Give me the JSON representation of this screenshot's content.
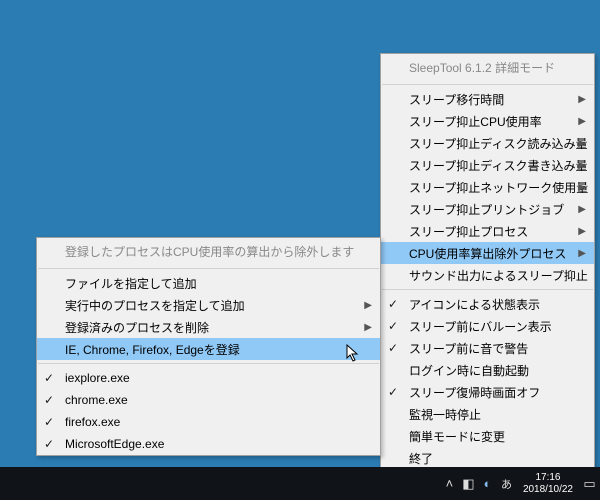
{
  "mainMenu": {
    "title": "SleepTool 6.1.2 詳細モード",
    "items": [
      {
        "label": "スリープ移行時間",
        "submenu": true
      },
      {
        "label": "スリープ抑止CPU使用率",
        "submenu": true
      },
      {
        "label": "スリープ抑止ディスク読み込み量",
        "submenu": true
      },
      {
        "label": "スリープ抑止ディスク書き込み量",
        "submenu": true
      },
      {
        "label": "スリープ抑止ネットワーク使用量",
        "submenu": true
      },
      {
        "label": "スリープ抑止プリントジョブ",
        "submenu": true
      },
      {
        "label": "スリープ抑止プロセス",
        "submenu": true
      },
      {
        "label": "CPU使用率算出除外プロセス",
        "submenu": true,
        "highlighted": true
      },
      {
        "label": "サウンド出力によるスリープ抑止"
      },
      {
        "sep": true
      },
      {
        "label": "アイコンによる状態表示",
        "checked": true
      },
      {
        "label": "スリープ前にバルーン表示",
        "checked": true
      },
      {
        "label": "スリープ前に音で警告",
        "checked": true
      },
      {
        "label": "ログイン時に自動起動"
      },
      {
        "label": "スリープ復帰時画面オフ",
        "checked": true
      },
      {
        "label": "監視一時停止"
      },
      {
        "label": "簡単モードに変更"
      },
      {
        "label": "終了"
      }
    ]
  },
  "subMenu": {
    "title": "登録したプロセスはCPU使用率の算出から除外します",
    "items": [
      {
        "label": "ファイルを指定して追加"
      },
      {
        "label": "実行中のプロセスを指定して追加",
        "submenu": true
      },
      {
        "label": "登録済みのプロセスを削除",
        "submenu": true
      },
      {
        "label": "IE, Chrome, Firefox, Edgeを登録",
        "highlighted": true
      },
      {
        "sep": true
      },
      {
        "label": "iexplore.exe",
        "checked": true
      },
      {
        "label": "chrome.exe",
        "checked": true
      },
      {
        "label": "firefox.exe",
        "checked": true
      },
      {
        "label": "MicrosoftEdge.exe",
        "checked": true
      }
    ]
  },
  "taskbar": {
    "time": "17:16",
    "date": "2018/10/22"
  }
}
